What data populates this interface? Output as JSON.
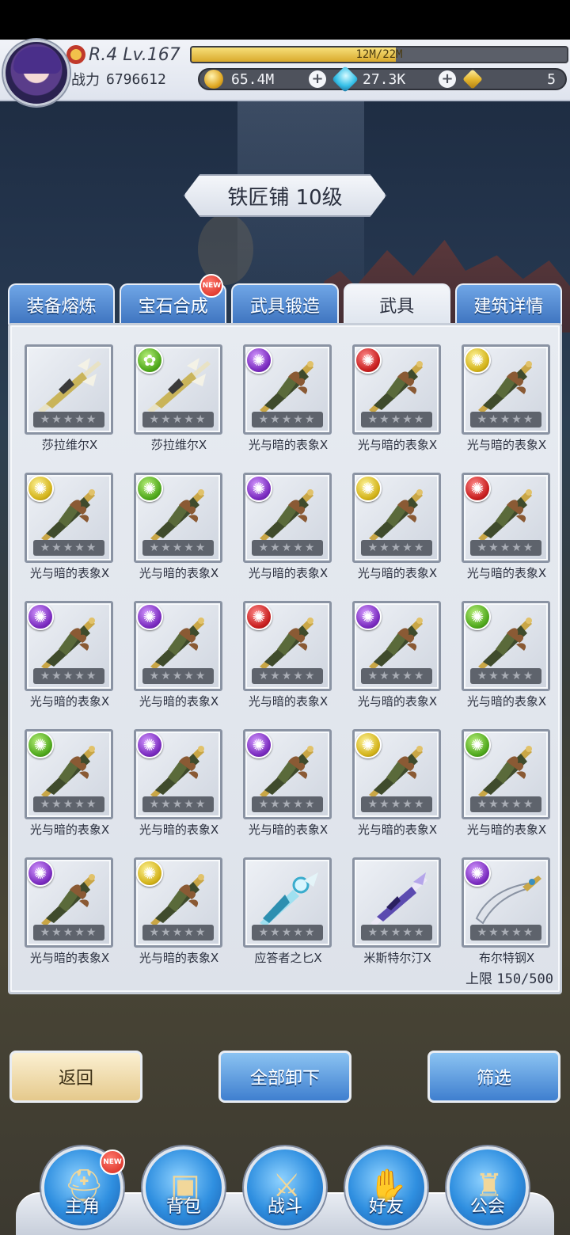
{
  "player": {
    "level_text": "R.4 Lv.167",
    "exp_text": "12M/22M",
    "exp_progress": 0.545,
    "power_label": "战力",
    "power_value": "6796612"
  },
  "resources": {
    "gold": "65.4M",
    "gems": "27.3K",
    "crystals": "5"
  },
  "building_title": "铁匠铺 10级",
  "tabs": [
    {
      "label": "装备熔炼",
      "active": false,
      "new": false
    },
    {
      "label": "宝石合成",
      "active": false,
      "new": true
    },
    {
      "label": "武具锻造",
      "active": false,
      "new": false
    },
    {
      "label": "武具",
      "active": true,
      "new": false
    },
    {
      "label": "建筑详情",
      "active": false,
      "new": false
    }
  ],
  "badge_new": "NEW",
  "items": [
    {
      "name": "莎拉维尔Ⅹ",
      "orb": "none",
      "weapon": "silver-spear"
    },
    {
      "name": "莎拉维尔Ⅹ",
      "orb": "leaf",
      "weapon": "silver-spear"
    },
    {
      "name": "光与暗的表象Ⅹ",
      "orb": "purple",
      "weapon": "dark-blade"
    },
    {
      "name": "光与暗的表象Ⅹ",
      "orb": "red",
      "weapon": "dark-blade"
    },
    {
      "name": "光与暗的表象Ⅹ",
      "orb": "yellow",
      "weapon": "dark-blade"
    },
    {
      "name": "光与暗的表象Ⅹ",
      "orb": "yellow",
      "weapon": "dark-blade"
    },
    {
      "name": "光与暗的表象Ⅹ",
      "orb": "green",
      "weapon": "dark-blade"
    },
    {
      "name": "光与暗的表象Ⅹ",
      "orb": "purple",
      "weapon": "dark-blade"
    },
    {
      "name": "光与暗的表象Ⅹ",
      "orb": "yellow",
      "weapon": "dark-blade"
    },
    {
      "name": "光与暗的表象Ⅹ",
      "orb": "red",
      "weapon": "dark-blade"
    },
    {
      "name": "光与暗的表象Ⅹ",
      "orb": "purple",
      "weapon": "dark-blade"
    },
    {
      "name": "光与暗的表象Ⅹ",
      "orb": "purple",
      "weapon": "dark-blade"
    },
    {
      "name": "光与暗的表象Ⅹ",
      "orb": "red",
      "weapon": "dark-blade"
    },
    {
      "name": "光与暗的表象Ⅹ",
      "orb": "purple",
      "weapon": "dark-blade"
    },
    {
      "name": "光与暗的表象Ⅹ",
      "orb": "green",
      "weapon": "dark-blade"
    },
    {
      "name": "光与暗的表象Ⅹ",
      "orb": "green",
      "weapon": "dark-blade"
    },
    {
      "name": "光与暗的表象Ⅹ",
      "orb": "purple",
      "weapon": "dark-blade"
    },
    {
      "name": "光与暗的表象Ⅹ",
      "orb": "purple",
      "weapon": "dark-blade"
    },
    {
      "name": "光与暗的表象Ⅹ",
      "orb": "yellow",
      "weapon": "dark-blade"
    },
    {
      "name": "光与暗的表象Ⅹ",
      "orb": "green",
      "weapon": "dark-blade"
    },
    {
      "name": "光与暗的表象Ⅹ",
      "orb": "purple",
      "weapon": "dark-blade"
    },
    {
      "name": "光与暗的表象Ⅹ",
      "orb": "yellow",
      "weapon": "dark-blade"
    },
    {
      "name": "应答者之匕Ⅹ",
      "orb": "none",
      "weapon": "ice-dagger"
    },
    {
      "name": "米斯特尔汀Ⅹ",
      "orb": "none",
      "weapon": "violet-sword"
    },
    {
      "name": "布尔特钢Ⅹ",
      "orb": "purple",
      "weapon": "scimitar"
    }
  ],
  "star_text": "★★★★★",
  "capacity": {
    "label": "上限",
    "value": "150/500"
  },
  "buttons": {
    "back": "返回",
    "unequip_all": "全部卸下",
    "filter": "筛选"
  },
  "nav": [
    {
      "label": "主角",
      "icon": "helmet-icon",
      "new": true
    },
    {
      "label": "背包",
      "icon": "backpack-icon",
      "new": false
    },
    {
      "label": "战斗",
      "icon": "crossed-swords-icon",
      "new": false
    },
    {
      "label": "好友",
      "icon": "handshake-icon",
      "new": false
    },
    {
      "label": "公会",
      "icon": "guild-crest-icon",
      "new": false
    }
  ],
  "colors": {
    "tab_blue": "#3e74bf",
    "orb_purple": "#7a2bbf",
    "orb_red": "#c81f1f",
    "orb_yellow": "#d3b31a",
    "orb_green": "#4fa81c",
    "exp_gold": "#d9a92c"
  }
}
